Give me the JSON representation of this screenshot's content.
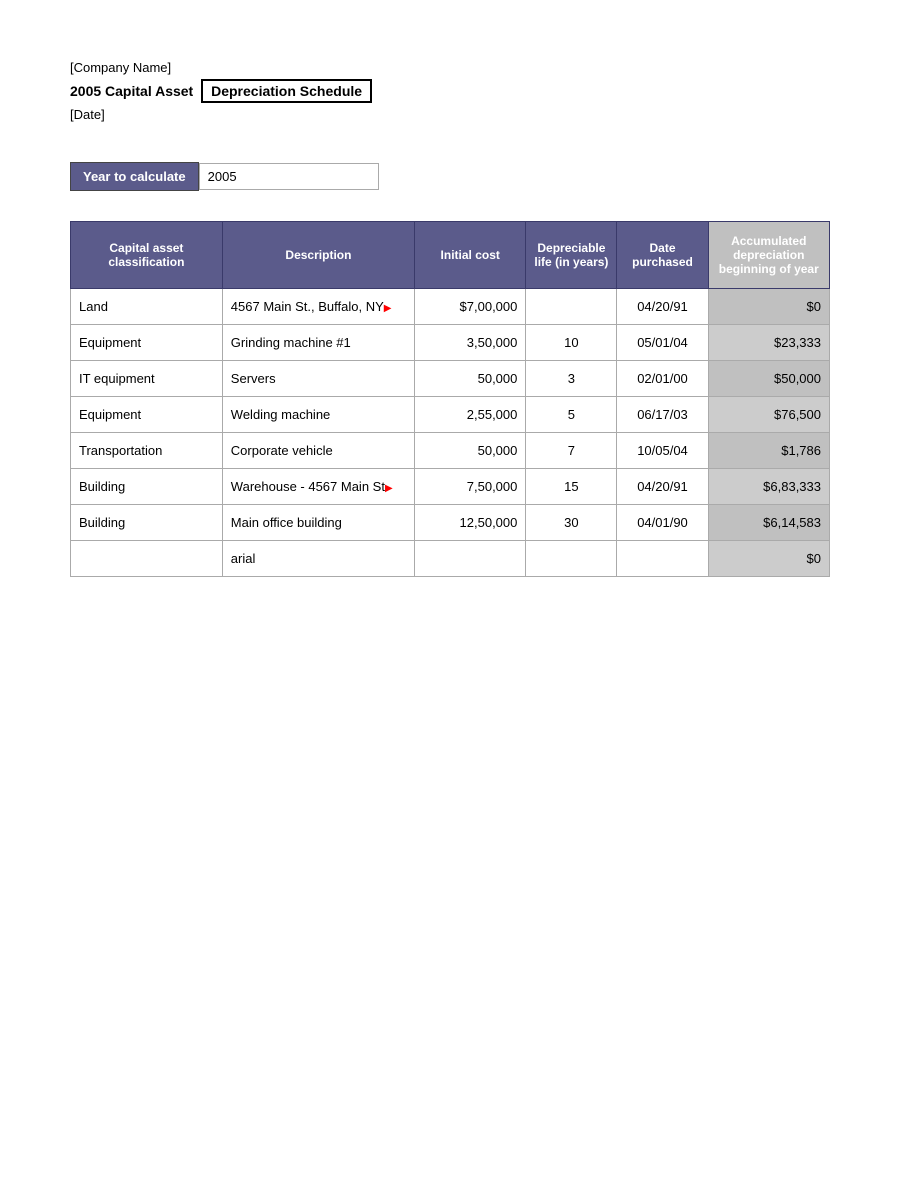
{
  "header": {
    "company_name": "[Company Name]",
    "report_title_prefix": "2005 Capital Asset",
    "report_title_box": "Depreciation Schedule",
    "date_label": "[Date]"
  },
  "year_section": {
    "label": "Year to calculate",
    "value": "2005"
  },
  "table": {
    "headers": {
      "classification": "Capital asset classification",
      "description": "Description",
      "initial_cost": "Initial cost",
      "depr_life": "Depreciable life (in years)",
      "date_purchased": "Date purchased",
      "accum_depr": "Accumulated depreciation beginning of year"
    },
    "rows": [
      {
        "classification": "Land",
        "description": "4567 Main St., Buffalo, NY",
        "initial_cost": "$7,00,000",
        "depr_life": "",
        "date_purchased": "04/20/91",
        "accum_depr": "$0",
        "overflow": true
      },
      {
        "classification": "Equipment",
        "description": "Grinding machine #1",
        "initial_cost": "3,50,000",
        "depr_life": "10",
        "date_purchased": "05/01/04",
        "accum_depr": "$23,333",
        "overflow": false
      },
      {
        "classification": "IT equipment",
        "description": "Servers",
        "initial_cost": "50,000",
        "depr_life": "3",
        "date_purchased": "02/01/00",
        "accum_depr": "$50,000",
        "overflow": false
      },
      {
        "classification": "Equipment",
        "description": "Welding machine",
        "initial_cost": "2,55,000",
        "depr_life": "5",
        "date_purchased": "06/17/03",
        "accum_depr": "$76,500",
        "overflow": false
      },
      {
        "classification": "Transportation",
        "description": "Corporate vehicle",
        "initial_cost": "50,000",
        "depr_life": "7",
        "date_purchased": "10/05/04",
        "accum_depr": "$1,786",
        "overflow": false
      },
      {
        "classification": "Building",
        "description": "Warehouse - 4567 Main St",
        "initial_cost": "7,50,000",
        "depr_life": "15",
        "date_purchased": "04/20/91",
        "accum_depr": "$6,83,333",
        "overflow": true
      },
      {
        "classification": "Building",
        "description": "Main office building",
        "initial_cost": "12,50,000",
        "depr_life": "30",
        "date_purchased": "04/01/90",
        "accum_depr": "$6,14,583",
        "overflow": false
      },
      {
        "classification": "",
        "description": "arial",
        "initial_cost": "",
        "depr_life": "",
        "date_purchased": "",
        "accum_depr": "$0",
        "overflow": false
      }
    ]
  }
}
